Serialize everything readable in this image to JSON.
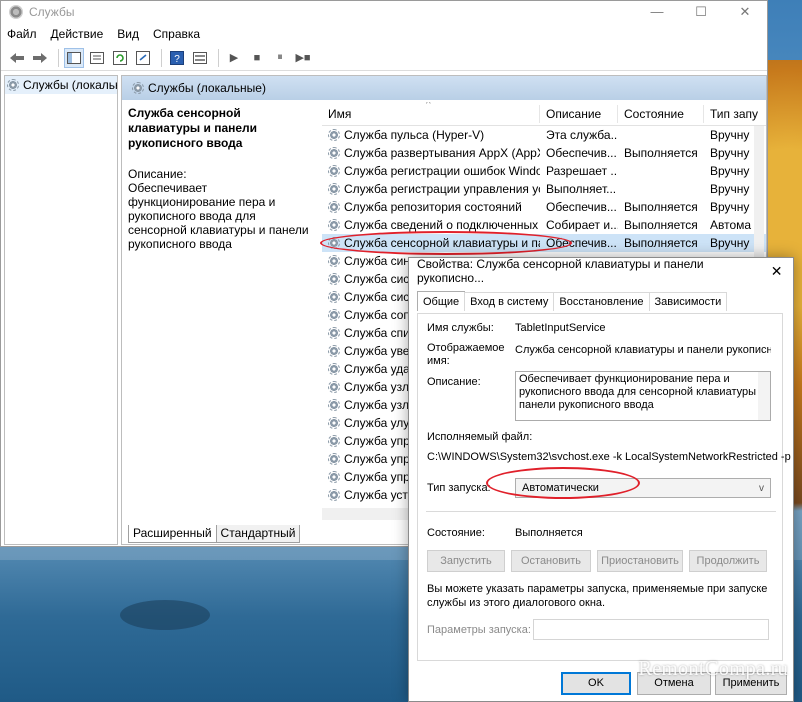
{
  "window": {
    "title": "Службы",
    "controls": {
      "minimize": "—",
      "maximize": "☐",
      "close": "✕"
    }
  },
  "menu": [
    "Файл",
    "Действие",
    "Вид",
    "Справка"
  ],
  "toolbar": {
    "back_icon": "arrow-left-icon",
    "forward_icon": "arrow-right-icon",
    "stop_glyph": "■",
    "pause_glyph": "⏸",
    "play_glyph": "▶",
    "restart_glyph": "▶■"
  },
  "tree": {
    "item": "Службы (локальн"
  },
  "pane": {
    "header": "Службы (локальные)",
    "selected_title": "Служба сенсорной клавиатуры и панели рукописного ввода",
    "desc_label": "Описание:",
    "desc_text": "Обеспечивает функционирование пера и рукописного ввода для сенсорной клавиатуры и панели рукописного ввода"
  },
  "columns": {
    "name": "Имя",
    "desc": "Описание",
    "state": "Состояние",
    "type": "Тип запу"
  },
  "services": [
    {
      "name": "Служба пульса (Hyper-V)",
      "desc": "Эта служба...",
      "state": "",
      "type": "Вручну"
    },
    {
      "name": "Служба развертывания AppX (AppXSVC)",
      "desc": "Обеспечив...",
      "state": "Выполняется",
      "type": "Вручну"
    },
    {
      "name": "Служба регистрации ошибок Windows",
      "desc": "Разрешает ...",
      "state": "",
      "type": "Вручну"
    },
    {
      "name": "Служба регистрации управления устройством",
      "desc": "Выполняет...",
      "state": "",
      "type": "Вручну"
    },
    {
      "name": "Служба репозитория состояний",
      "desc": "Обеспечив...",
      "state": "Выполняется",
      "type": "Вручну"
    },
    {
      "name": "Служба сведений о подключенных сетях",
      "desc": "Собирает и...",
      "state": "Выполняется",
      "type": "Автома"
    },
    {
      "name": "Служба сенсорной клавиатуры и панели рукописного ввода",
      "desc": "Обеспечив...",
      "state": "Выполняется",
      "type": "Вручну"
    },
    {
      "name": "Служба син",
      "desc": "",
      "state": "",
      "type": ""
    },
    {
      "name": "Служба сис",
      "desc": "",
      "state": "",
      "type": ""
    },
    {
      "name": "Служба сис",
      "desc": "",
      "state": "",
      "type": ""
    },
    {
      "name": "Служба соп",
      "desc": "",
      "state": "",
      "type": ""
    },
    {
      "name": "Служба спи",
      "desc": "",
      "state": "",
      "type": ""
    },
    {
      "name": "Служба уве",
      "desc": "",
      "state": "",
      "type": ""
    },
    {
      "name": "Служба уда",
      "desc": "",
      "state": "",
      "type": ""
    },
    {
      "name": "Служба узла",
      "desc": "",
      "state": "",
      "type": ""
    },
    {
      "name": "Служба узла",
      "desc": "",
      "state": "",
      "type": ""
    },
    {
      "name": "Служба улу",
      "desc": "",
      "state": "",
      "type": ""
    },
    {
      "name": "Служба упр",
      "desc": "",
      "state": "",
      "type": ""
    },
    {
      "name": "Служба упр",
      "desc": "",
      "state": "",
      "type": ""
    },
    {
      "name": "Служба упр",
      "desc": "",
      "state": "",
      "type": ""
    },
    {
      "name": "Служба уста",
      "desc": "",
      "state": "",
      "type": ""
    }
  ],
  "bottom_tabs": [
    "Расширенный",
    "Стандартный"
  ],
  "dialog": {
    "title": "Свойства: Служба сенсорной клавиатуры и панели рукописно...",
    "close": "✕",
    "tabs": [
      "Общие",
      "Вход в систему",
      "Восстановление",
      "Зависимости"
    ],
    "service_name_label": "Имя службы:",
    "service_name": "TabletInputService",
    "display_name_label": "Отображаемое имя:",
    "display_name": "Служба сенсорной клавиатуры и панели рукописного ввода",
    "description_label": "Описание:",
    "description": "Обеспечивает функционирование пера и рукописного ввода для сенсорной клавиатуры и панели рукописного ввода",
    "exe_label": "Исполняемый файл:",
    "exe_path": "C:\\WINDOWS\\System32\\svchost.exe -k LocalSystemNetworkRestricted -p",
    "startup_label": "Тип запуска:",
    "startup_value": "Автоматически",
    "status_label": "Состояние:",
    "status_value": "Выполняется",
    "btn_start": "Запустить",
    "btn_stop": "Остановить",
    "btn_pause": "Приостановить",
    "btn_resume": "Продолжить",
    "hint": "Вы можете указать параметры запуска, применяемые при запуске службы из этого диалогового окна.",
    "params_label": "Параметры запуска:",
    "params_value": "",
    "ok": "OK",
    "cancel": "Отмена",
    "apply": "Применить"
  },
  "watermark": "RemontCompa.ru",
  "colors": {
    "highlight_oval": "#e0202a",
    "selected_row": "#cde3f7",
    "pane_header": "#c4d8ee"
  }
}
